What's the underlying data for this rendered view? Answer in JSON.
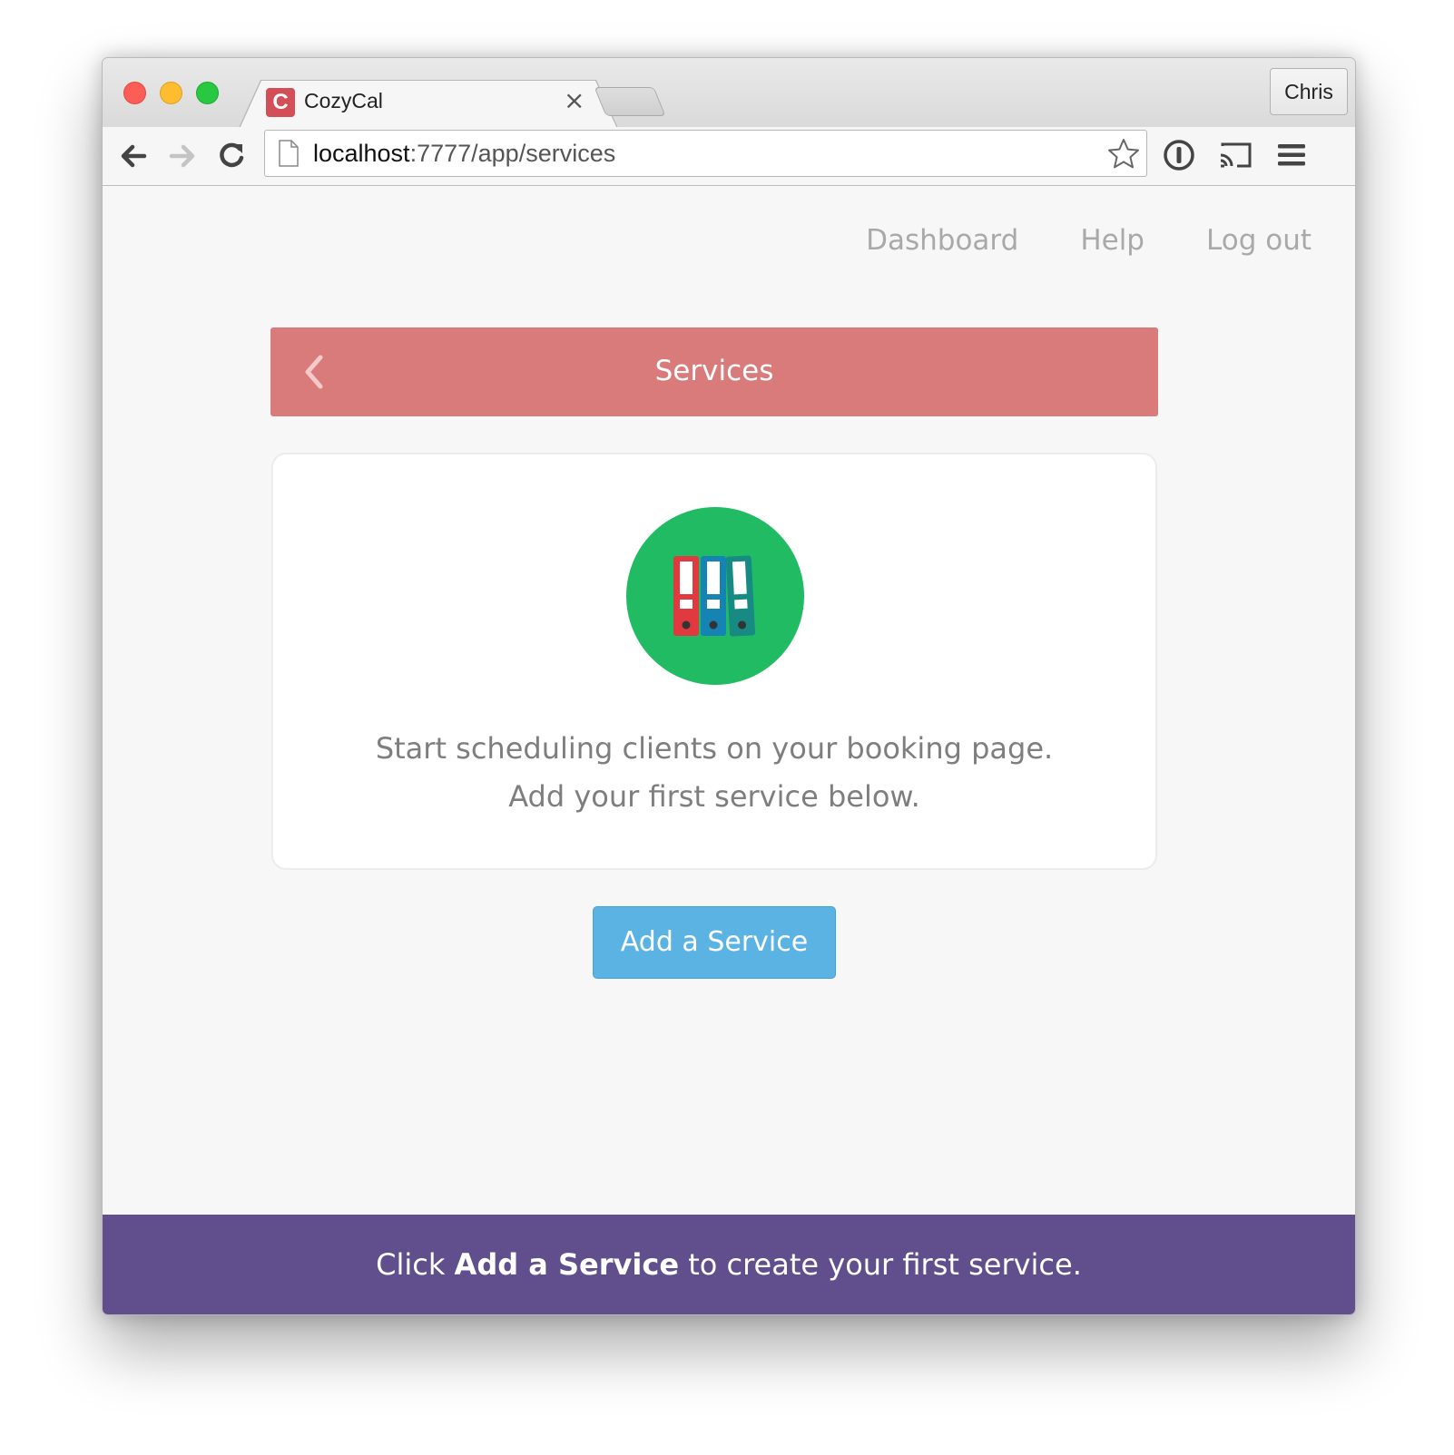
{
  "browser": {
    "tab_title": "CozyCal",
    "favicon_letter": "C",
    "tab_close": "×",
    "profile_name": "Chris",
    "url_host": "localhost",
    "url_path": ":7777/app/services"
  },
  "nav": {
    "items": [
      "Dashboard",
      "Help",
      "Log out"
    ]
  },
  "header": {
    "title": "Services"
  },
  "card": {
    "line1": "Start scheduling clients on your booking page.",
    "line2": "Add your first service below."
  },
  "actions": {
    "add_service_label": "Add a Service"
  },
  "footer": {
    "prefix": "Click ",
    "highlight": "Add a Service",
    "suffix": " to create your first service."
  },
  "colors": {
    "header_bar": "#d97b7b",
    "icon_circle": "#21bb63",
    "button": "#5ab3e3",
    "footer_bar": "#604f8c",
    "favicon": "#d24f58"
  },
  "icons": {
    "back": "chevron-left-icon",
    "illustration": "binders-icon",
    "bookmark": "star-icon",
    "password_manager": "info-circle-icon",
    "cast": "cast-icon",
    "menu": "hamburger-icon"
  }
}
